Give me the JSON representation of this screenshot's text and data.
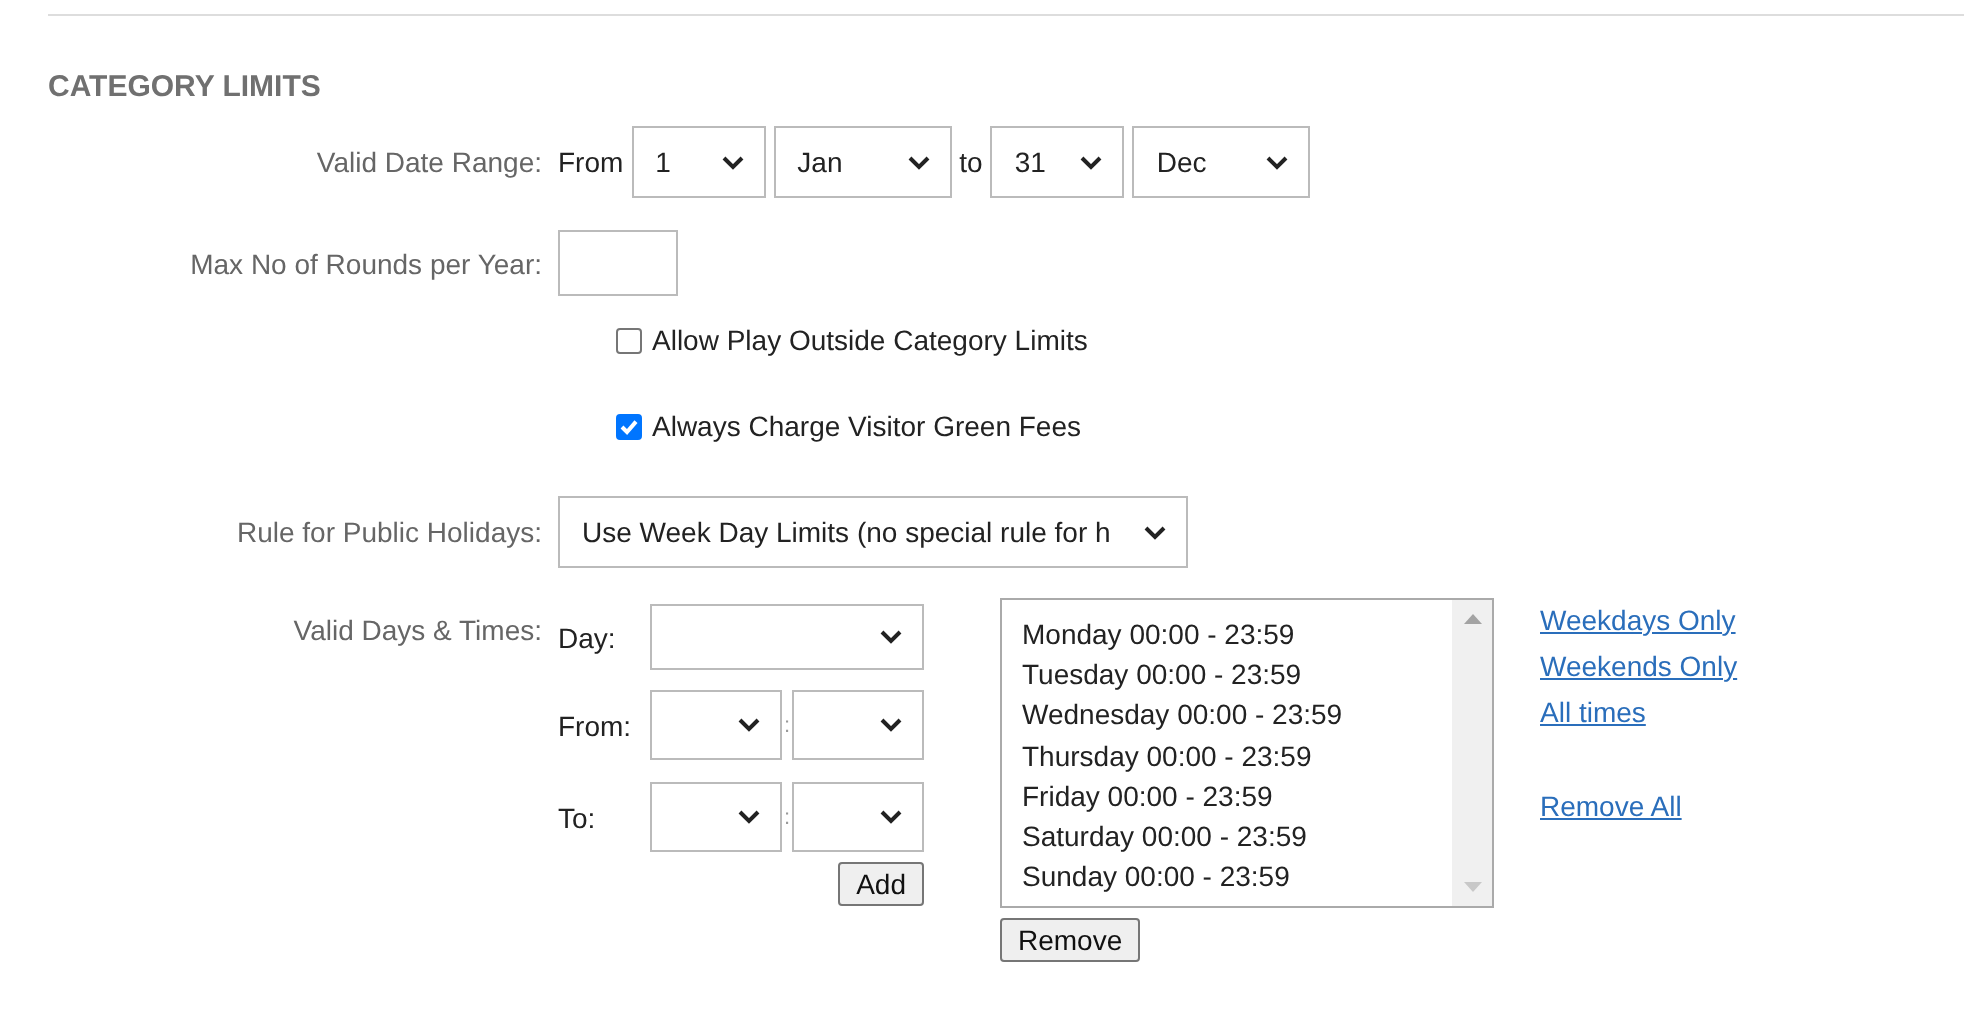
{
  "section_title": "CATEGORY LIMITS",
  "date_range": {
    "label": "Valid Date Range:",
    "from_label": "From",
    "from_day": {
      "value": "1"
    },
    "from_month": {
      "value": "Jan"
    },
    "to_label": "to",
    "to_day": {
      "value": "31"
    },
    "to_month": {
      "value": "Dec"
    }
  },
  "max_rounds": {
    "label": "Max No of Rounds per Year:"
  },
  "checkboxes": [
    {
      "label": "Allow Play Outside Category Limits",
      "checked": false
    },
    {
      "label": "Always Charge Visitor Green Fees",
      "checked": true
    }
  ],
  "holidays": {
    "label": "Rule for Public Holidays:",
    "value": "Use Week Day Limits (no special rule for h"
  },
  "days_times": {
    "label": "Valid Days & Times:",
    "day_label": "Day:",
    "from_label": "From:",
    "from_separator": ":",
    "to_label": "To:",
    "to_separator": ":",
    "add_button": "Add",
    "list": [
      "Monday 00:00 - 23:59",
      "Tuesday 00:00 - 23:59",
      "Wednesday 00:00 - 23:59",
      "Thursday 00:00 - 23:59",
      "Friday 00:00 - 23:59",
      "Saturday 00:00 - 23:59",
      "Sunday 00:00 - 23:59"
    ],
    "remove_button": "Remove",
    "preset_links": [
      "Weekdays Only",
      "Weekends Only",
      "All times"
    ],
    "remove_all_link": "Remove All"
  }
}
